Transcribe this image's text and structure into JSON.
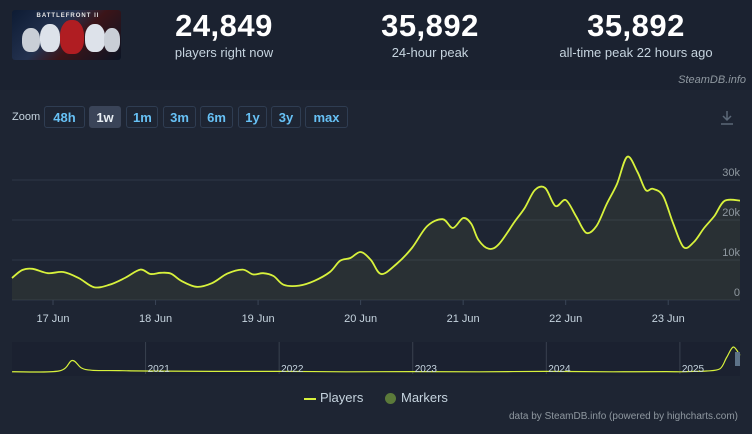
{
  "stats": [
    {
      "value": "24,849",
      "label": "players right now"
    },
    {
      "value": "35,892",
      "label": "24-hour peak"
    },
    {
      "value": "35,892",
      "label": "all-time peak 22 hours ago"
    }
  ],
  "game_thumb_text": "BATTLEFRONT II",
  "credit_top": "SteamDB.info",
  "zoom": {
    "label": "Zoom",
    "buttons": [
      "48h",
      "1w",
      "1m",
      "3m",
      "6m",
      "1y",
      "3y",
      "max"
    ],
    "active": "1w"
  },
  "legend": {
    "players": "Players",
    "markers": "Markers"
  },
  "credit_bottom": "data by SteamDB.info (powered by highcharts.com)",
  "colors": {
    "line": "#d8f23c",
    "grid": "#2e3747",
    "background": "#1e2533",
    "accent": "#67c1f5"
  },
  "chart_data": [
    {
      "type": "line",
      "x_ticks": [
        "17 Jun",
        "18 Jun",
        "19 Jun",
        "20 Jun",
        "21 Jun",
        "22 Jun",
        "23 Jun"
      ],
      "y_ticks": [
        "0",
        "10k",
        "20k",
        "30k"
      ],
      "ylim": [
        0,
        40000
      ],
      "xlim": [
        16.6,
        23.7
      ],
      "grid": true,
      "series": [
        {
          "name": "Players",
          "x": [
            16.6,
            16.7,
            16.8,
            16.95,
            17.1,
            17.25,
            17.4,
            17.55,
            17.7,
            17.85,
            17.95,
            18.05,
            18.15,
            18.25,
            18.4,
            18.55,
            18.7,
            18.85,
            18.95,
            19.05,
            19.15,
            19.25,
            19.4,
            19.55,
            19.7,
            19.8,
            19.9,
            20.0,
            20.1,
            20.2,
            20.35,
            20.5,
            20.65,
            20.8,
            20.9,
            21.0,
            21.08,
            21.15,
            21.25,
            21.35,
            21.5,
            21.6,
            21.7,
            21.8,
            21.9,
            22.0,
            22.1,
            22.2,
            22.3,
            22.4,
            22.5,
            22.6,
            22.7,
            22.78,
            22.85,
            22.95,
            23.05,
            23.15,
            23.25,
            23.35,
            23.45,
            23.55,
            23.7
          ],
          "values": [
            5500,
            7500,
            7800,
            6700,
            7000,
            5500,
            3200,
            3800,
            5500,
            7600,
            6500,
            6800,
            6600,
            4800,
            3300,
            4200,
            6600,
            7600,
            6400,
            6700,
            6000,
            3800,
            3600,
            4800,
            7000,
            9800,
            10500,
            12000,
            10000,
            6500,
            9000,
            13000,
            18500,
            20200,
            18000,
            20500,
            19000,
            15000,
            12800,
            14000,
            19500,
            23000,
            27500,
            28000,
            23500,
            25000,
            21000,
            16800,
            18500,
            24000,
            29000,
            35800,
            32000,
            27500,
            27800,
            26000,
            19000,
            13200,
            14500,
            18000,
            21000,
            24800,
            24849
          ]
        }
      ]
    },
    {
      "type": "line",
      "x_ticks": [
        "2021",
        "2022",
        "2023",
        "2024",
        "2025"
      ],
      "series": [
        {
          "name": "Players",
          "x": [
            2020.0,
            2020.35,
            2020.45,
            2020.52,
            2020.6,
            2020.8,
            2021.0,
            2021.5,
            2022.0,
            2022.5,
            2023.0,
            2023.5,
            2024.0,
            2024.5,
            2024.9,
            2025.0,
            2025.1,
            2025.2,
            2025.3,
            2025.35,
            2025.4,
            2025.45
          ],
          "values": [
            3000,
            4000,
            18000,
            8000,
            5000,
            4500,
            4000,
            3500,
            3500,
            3000,
            3200,
            3000,
            3500,
            3000,
            3200,
            3000,
            3500,
            4000,
            7000,
            22000,
            36000,
            24849
          ]
        }
      ]
    }
  ]
}
